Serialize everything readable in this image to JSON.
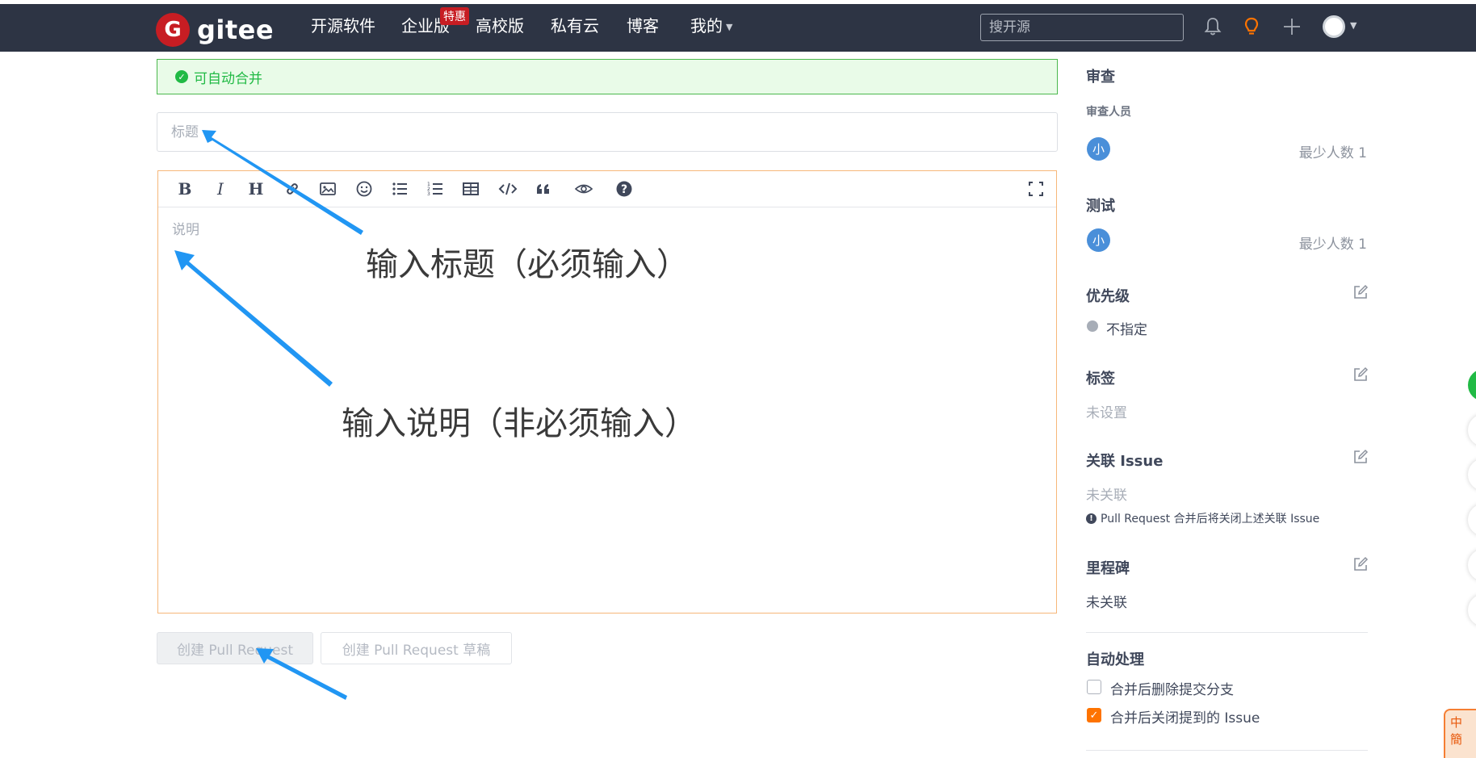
{
  "nav": {
    "logo_letter": "G",
    "logo_text": "gitee",
    "items": [
      "开源软件",
      "企业版",
      "高校版",
      "私有云",
      "博客",
      "我的"
    ],
    "promo_badge": "特惠",
    "search_placeholder": "搜开源"
  },
  "form": {
    "merge_status": "可自动合并",
    "title_placeholder": "标题",
    "description_placeholder": "说明",
    "toolbar": [
      "bold-icon",
      "italic-icon",
      "heading-icon",
      "link-icon",
      "image-icon",
      "emoji-icon",
      "bullet-list-icon",
      "ordered-list-icon",
      "table-icon",
      "code-icon",
      "quote-icon",
      "preview-icon",
      "help-icon",
      "fullscreen-icon"
    ],
    "create_button": "创建 Pull Request",
    "draft_button": "创建 Pull Request 草稿"
  },
  "annotations": {
    "title_hint": "输入标题（必须输入）",
    "description_hint": "输入说明（非必须输入）"
  },
  "sidebar": {
    "review": {
      "heading": "审查",
      "reviewers_label": "审查人员",
      "reviewer_avatar": "小",
      "reviewer_min": "最少人数 1"
    },
    "testing": {
      "heading": "测试",
      "tester_avatar": "小",
      "tester_min": "最少人数 1"
    },
    "priority": {
      "heading": "优先级",
      "value": "不指定"
    },
    "labels": {
      "heading": "标签",
      "value": "未设置"
    },
    "issue": {
      "heading": "关联 Issue",
      "value": "未关联",
      "note": "Pull Request 合并后将关闭上述关联 Issue"
    },
    "milestone": {
      "heading": "里程碑",
      "value": "未关联"
    },
    "auto": {
      "heading": "自动处理",
      "options": [
        {
          "label": "合并后删除提交分支",
          "checked": false
        },
        {
          "label": "合并后关闭提到的 Issue",
          "checked": true
        }
      ]
    }
  },
  "ime": {
    "text": "中 簡"
  },
  "colors": {
    "nav_bg": "#2d3444",
    "brand_red": "#c71d23",
    "success_green": "#21ba45",
    "accent_orange": "#fe7300",
    "annotation_arrow": "#2196f3"
  }
}
